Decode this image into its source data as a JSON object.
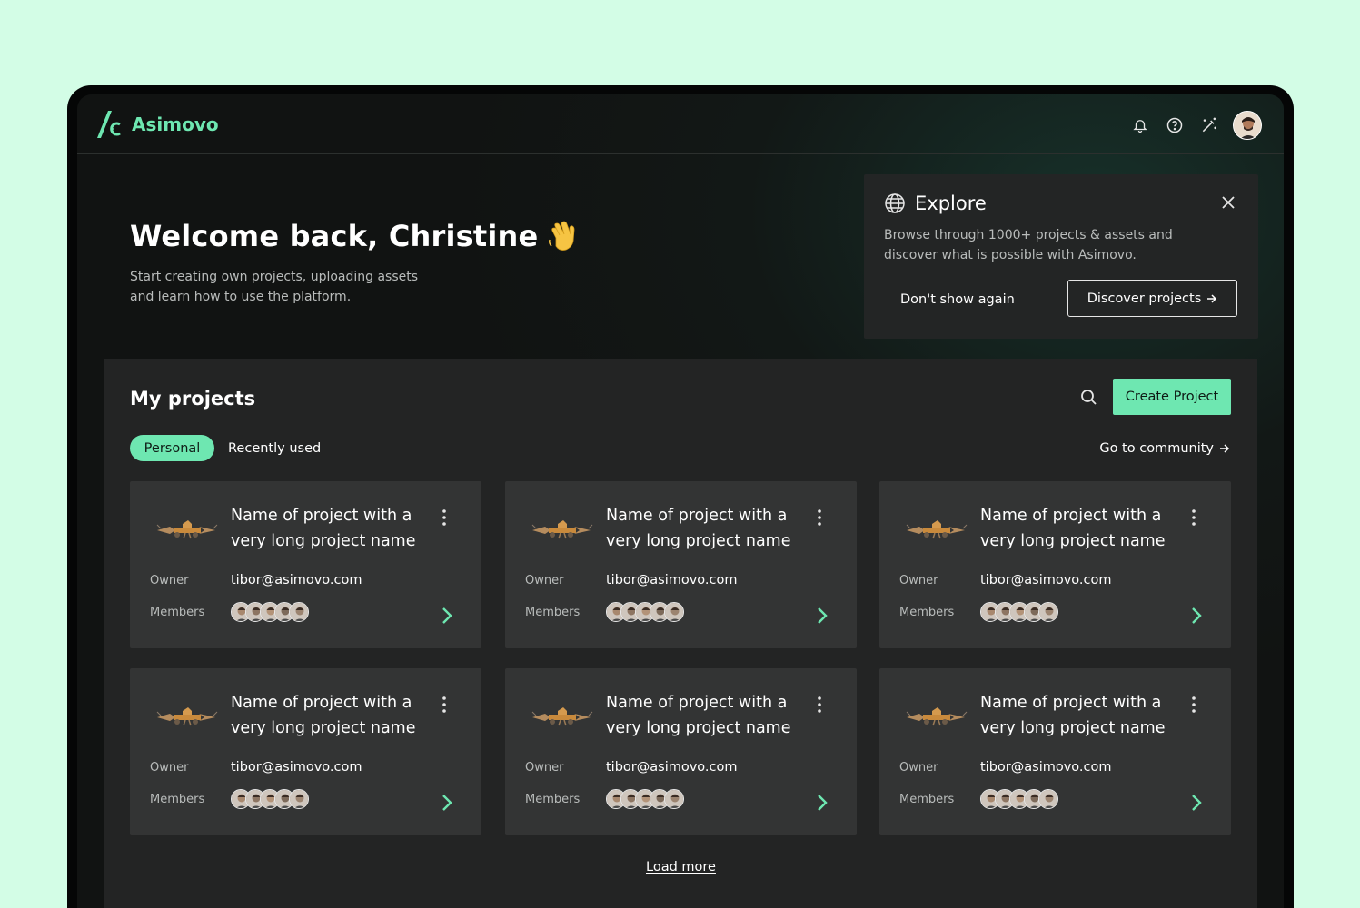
{
  "brand": {
    "name": "Asimovo",
    "accent": "#6ee7b1"
  },
  "header": {
    "icons": [
      "bell-icon",
      "help-icon",
      "magic-wand-icon"
    ]
  },
  "welcome": {
    "title": "Welcome back, Christine",
    "subtitle": "Start creating own projects, uploading assets and learn how to use the platform."
  },
  "explore": {
    "title": "Explore",
    "description": "Browse through 1000+ projects & assets and discover what is possible with Asimovo.",
    "dismiss_label": "Don't show again",
    "discover_label": "Discover projects"
  },
  "projects": {
    "title": "My projects",
    "create_label": "Create Project",
    "tabs": [
      {
        "label": "Personal",
        "active": true
      },
      {
        "label": "Recently used",
        "active": false
      }
    ],
    "community_label": "Go to community",
    "owner_label": "Owner",
    "members_label": "Members",
    "cards": [
      {
        "title": "Name of project with a very long project name",
        "owner": "tibor@asimovo.com",
        "member_count": 5
      },
      {
        "title": "Name of project with a very long project name",
        "owner": "tibor@asimovo.com",
        "member_count": 5
      },
      {
        "title": "Name of project with a very long project name",
        "owner": "tibor@asimovo.com",
        "member_count": 5
      },
      {
        "title": "Name of project with a very long project name",
        "owner": "tibor@asimovo.com",
        "member_count": 5
      },
      {
        "title": "Name of project with a very long project name",
        "owner": "tibor@asimovo.com",
        "member_count": 5
      },
      {
        "title": "Name of project with a very long project name",
        "owner": "tibor@asimovo.com",
        "member_count": 5
      }
    ],
    "load_more_label": "Load more"
  }
}
